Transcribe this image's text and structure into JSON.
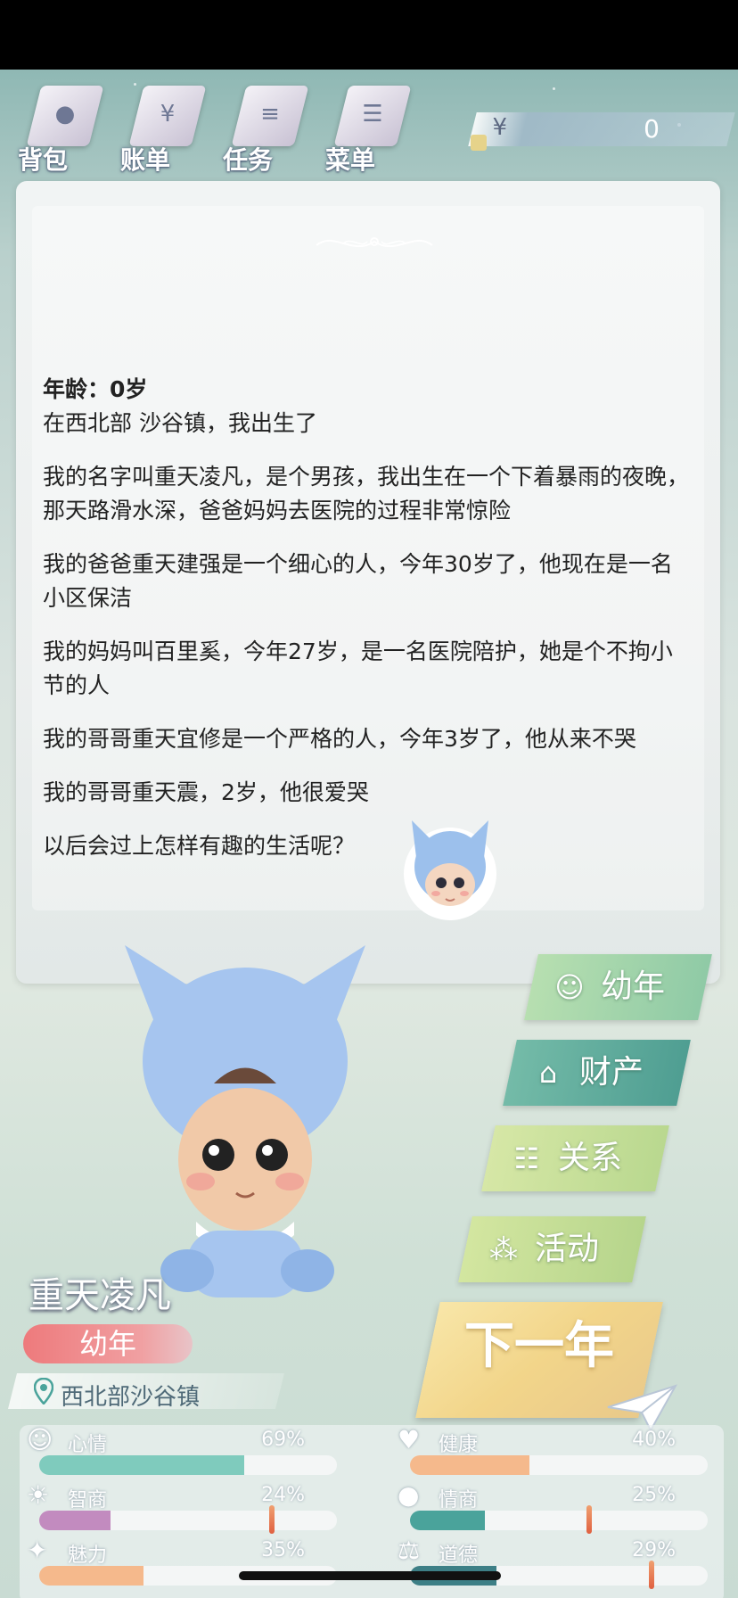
{
  "toolbar": {
    "items": [
      {
        "label": "背包",
        "icon": "bag-icon"
      },
      {
        "label": "账单",
        "icon": "bill-icon"
      },
      {
        "label": "任务",
        "icon": "task-icon"
      },
      {
        "label": "菜单",
        "icon": "menu-icon"
      }
    ],
    "money": {
      "symbol": "¥",
      "value": "0"
    }
  },
  "story": {
    "age": "年龄：0岁",
    "paragraphs": [
      "在西北部 沙谷镇，我出生了",
      "我的名字叫重天凌凡，是个男孩，我出生在一个下着暴雨的夜晚，那天路滑水深，爸爸妈妈去医院的过程非常惊险",
      "我的爸爸重天建强是一个细心的人，今年30岁了，他现在是一名小区保洁",
      "我的妈妈叫百里奚，今年27岁，是一名医院陪护，她是个不拘小节的人",
      "我的哥哥重天宜修是一个严格的人，今年3岁了，他从来不哭",
      "我的哥哥重天震，2岁，他很爱哭",
      "以后会过上怎样有趣的生活呢？"
    ]
  },
  "character": {
    "name": "重天凌凡",
    "stage": "幼年",
    "location": "西北部沙谷镇"
  },
  "menu": {
    "stage_label": "幼年",
    "property_label": "财产",
    "relations_label": "关系",
    "activity_label": "活动",
    "next_year_label": "下一年"
  },
  "stats": [
    {
      "label": "心情",
      "value": "69%",
      "fraction": 0.69,
      "icon": "smile-icon",
      "color": "#7fcbbd"
    },
    {
      "label": "健康",
      "value": "40%",
      "fraction": 0.4,
      "icon": "heart-icon",
      "color": "#f5b98c"
    },
    {
      "label": "智商",
      "value": "24%",
      "fraction": 0.24,
      "icon": "lightbulb-icon",
      "color": "#c28bbf"
    },
    {
      "label": "情商",
      "value": "25%",
      "fraction": 0.25,
      "icon": "apple-icon",
      "color": "#4aa39b"
    },
    {
      "label": "魅力",
      "value": "35%",
      "fraction": 0.35,
      "icon": "sparkle-icon",
      "color": "#f5b98c"
    },
    {
      "label": "道德",
      "value": "29%",
      "fraction": 0.29,
      "icon": "scale-icon",
      "color": "#3d7f86"
    }
  ],
  "colors": {
    "stage_pill": "#ee7a7c",
    "stage_button": "#9fd0a6",
    "property_button": "#6fb6a2",
    "relations_button": "#c8de9a",
    "activity_button": "#c2da96",
    "next_button": "#f2d58a"
  }
}
